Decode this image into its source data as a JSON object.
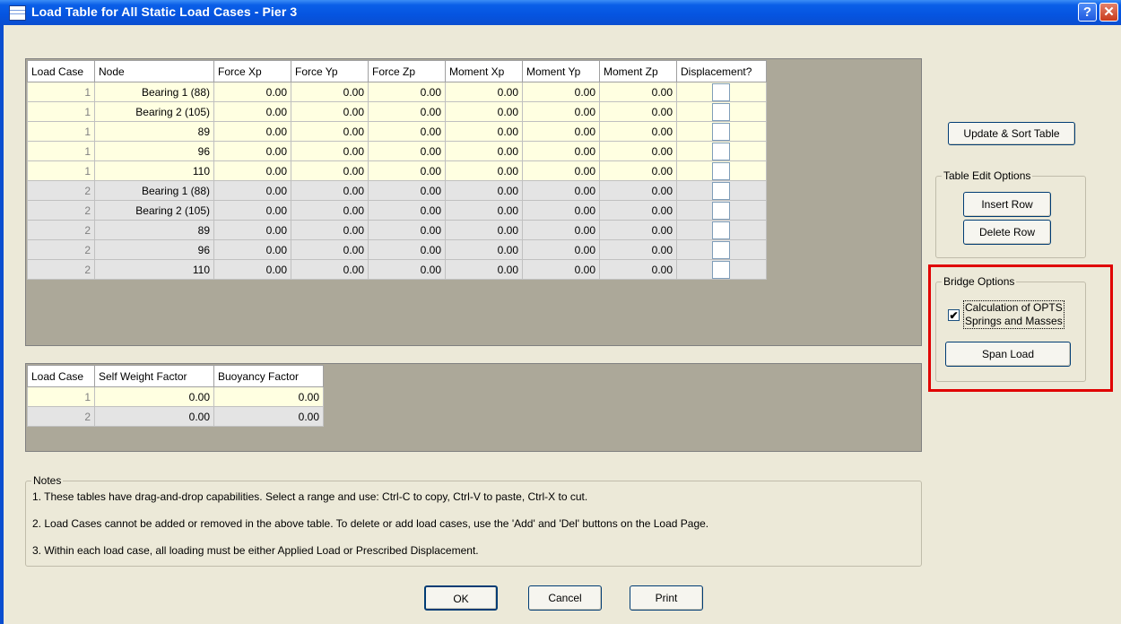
{
  "window": {
    "title": "Load Table for All Static Load Cases - Pier 3",
    "help_glyph": "?",
    "close_glyph": "✕"
  },
  "main_table": {
    "headers": [
      "Load Case",
      "Node",
      "Force Xp",
      "Force Yp",
      "Force Zp",
      "Moment Xp",
      "Moment Yp",
      "Moment Zp",
      "Displacement?"
    ],
    "rows": [
      {
        "lc": "1",
        "node": "Bearing 1 (88)",
        "fx": "0.00",
        "fy": "0.00",
        "fz": "0.00",
        "mx": "0.00",
        "my": "0.00",
        "mz": "0.00",
        "disp": false
      },
      {
        "lc": "1",
        "node": "Bearing 2 (105)",
        "fx": "0.00",
        "fy": "0.00",
        "fz": "0.00",
        "mx": "0.00",
        "my": "0.00",
        "mz": "0.00",
        "disp": false
      },
      {
        "lc": "1",
        "node": "89",
        "fx": "0.00",
        "fy": "0.00",
        "fz": "0.00",
        "mx": "0.00",
        "my": "0.00",
        "mz": "0.00",
        "disp": false
      },
      {
        "lc": "1",
        "node": "96",
        "fx": "0.00",
        "fy": "0.00",
        "fz": "0.00",
        "mx": "0.00",
        "my": "0.00",
        "mz": "0.00",
        "disp": false
      },
      {
        "lc": "1",
        "node": "110",
        "fx": "0.00",
        "fy": "0.00",
        "fz": "0.00",
        "mx": "0.00",
        "my": "0.00",
        "mz": "0.00",
        "disp": false
      },
      {
        "lc": "2",
        "node": "Bearing 1 (88)",
        "fx": "0.00",
        "fy": "0.00",
        "fz": "0.00",
        "mx": "0.00",
        "my": "0.00",
        "mz": "0.00",
        "disp": false
      },
      {
        "lc": "2",
        "node": "Bearing 2 (105)",
        "fx": "0.00",
        "fy": "0.00",
        "fz": "0.00",
        "mx": "0.00",
        "my": "0.00",
        "mz": "0.00",
        "disp": false
      },
      {
        "lc": "2",
        "node": "89",
        "fx": "0.00",
        "fy": "0.00",
        "fz": "0.00",
        "mx": "0.00",
        "my": "0.00",
        "mz": "0.00",
        "disp": false
      },
      {
        "lc": "2",
        "node": "96",
        "fx": "0.00",
        "fy": "0.00",
        "fz": "0.00",
        "mx": "0.00",
        "my": "0.00",
        "mz": "0.00",
        "disp": false
      },
      {
        "lc": "2",
        "node": "110",
        "fx": "0.00",
        "fy": "0.00",
        "fz": "0.00",
        "mx": "0.00",
        "my": "0.00",
        "mz": "0.00",
        "disp": false
      }
    ]
  },
  "factor_table": {
    "headers": [
      "Load Case",
      "Self Weight Factor",
      "Buoyancy Factor"
    ],
    "rows": [
      {
        "lc": "1",
        "sw": "0.00",
        "bf": "0.00"
      },
      {
        "lc": "2",
        "sw": "0.00",
        "bf": "0.00"
      }
    ]
  },
  "side": {
    "update_sort": "Update & Sort Table",
    "table_edit": {
      "label": "Table Edit Options",
      "insert": "Insert Row",
      "delete": "Delete Row"
    },
    "bridge": {
      "label": "Bridge Options",
      "opts_line1": "Calculation of OPTS",
      "opts_line2": "Springs and Masses",
      "opts_checked": true,
      "span_load": "Span Load"
    }
  },
  "notes": {
    "label": "Notes",
    "lines": [
      "1.  These tables have drag-and-drop capabilities. Select a range and use: Ctrl-C to copy, Ctrl-V to paste, Ctrl-X to cut.",
      "2.  Load Cases cannot be added or removed in the above table.  To delete or add load cases, use the 'Add' and 'Del' buttons on the Load Page.",
      "3.  Within each load case, all loading must be either Applied Load or Prescribed Displacement."
    ]
  },
  "footer": {
    "ok": "OK",
    "cancel": "Cancel",
    "print": "Print"
  },
  "colors": {
    "highlight": "#e00000",
    "row_case1": "#ffffe1",
    "row_case2": "#e4e4e4",
    "grid_bg": "#aca899"
  }
}
